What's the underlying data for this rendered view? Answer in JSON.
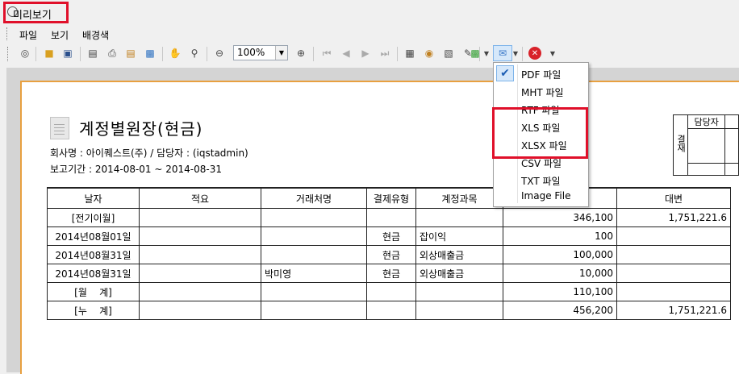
{
  "window": {
    "title": "미리보기"
  },
  "menu": {
    "items": [
      "파일",
      "보기",
      "배경색"
    ]
  },
  "toolbar": {
    "zoom_value": "100%"
  },
  "document": {
    "title": "계정별원장(현금)",
    "company_line": "회사명 : 아이퀘스트(주) / 담당자 : (iqstadmin)",
    "period_line": "보고기간 : 2014-08-01 ~ 2014-08-31",
    "approval": {
      "role": "담당자",
      "label": "결재"
    }
  },
  "ledger": {
    "headers": [
      "날자",
      "적요",
      "거래처명",
      "결제유형",
      "계정과목",
      "",
      "대변"
    ],
    "rows": [
      [
        "[전기이월]",
        "",
        "",
        "",
        "",
        "346,100",
        "1,751,221.6"
      ],
      [
        "2014년08월01일",
        "",
        "",
        "현금",
        "잡이익",
        "100",
        ""
      ],
      [
        "2014년08월31일",
        "",
        "",
        "현금",
        "외상매출금",
        "100,000",
        ""
      ],
      [
        "2014년08월31일",
        "",
        "박미영",
        "현금",
        "외상매출금",
        "10,000",
        ""
      ],
      [
        "[월    계]",
        "",
        "",
        "",
        "",
        "110,100",
        ""
      ],
      [
        "[누    계]",
        "",
        "",
        "",
        "",
        "456,200",
        "1,751,221.6"
      ]
    ]
  },
  "export_menu": {
    "items": [
      "PDF 파일",
      "MHT 파일",
      "RTF 파일",
      "XLS 파일",
      "XLSX 파일",
      "CSV 파일",
      "TXT 파일",
      "Image File"
    ],
    "checked_index": 0
  },
  "colors": {
    "highlight": "#e0102a",
    "paper_border": "#e8a040"
  }
}
